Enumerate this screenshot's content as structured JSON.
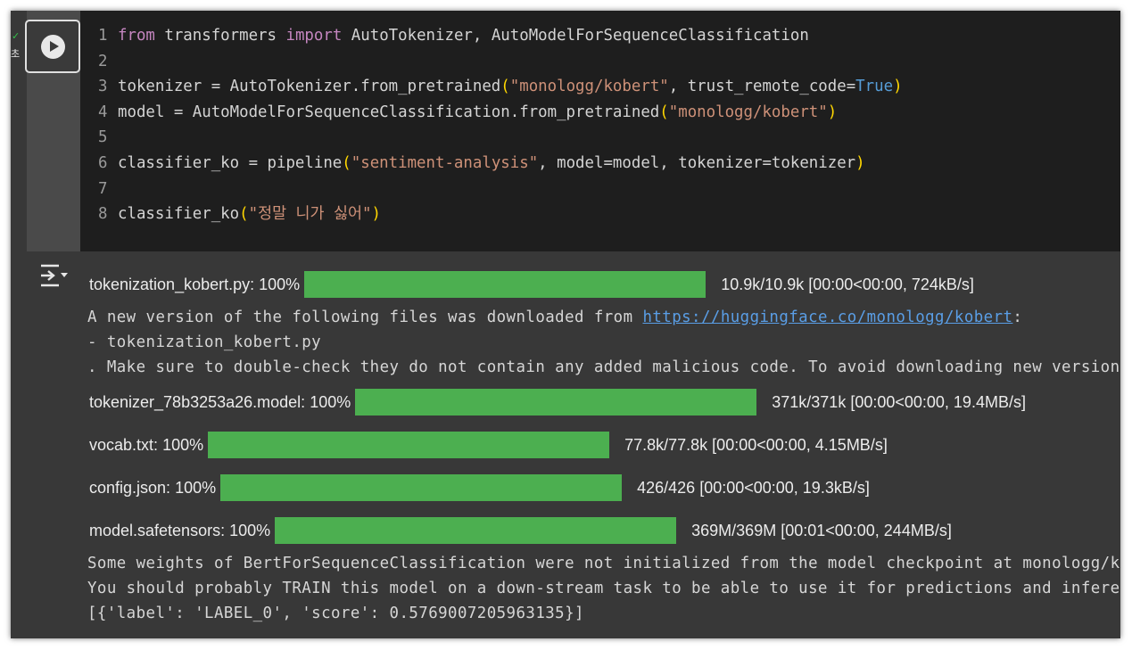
{
  "cell": {
    "status_check": "✓",
    "status_time": "초",
    "code_lines": [
      {
        "n": "1",
        "parts": [
          [
            "kw",
            "from"
          ],
          [
            "p",
            " transformers "
          ],
          [
            "kw",
            "import"
          ],
          [
            "p",
            " AutoTokenizer, AutoModelForSequenceClassification"
          ]
        ]
      },
      {
        "n": "2",
        "parts": []
      },
      {
        "n": "3",
        "parts": [
          [
            "p",
            "tokenizer = AutoTokenizer.from_pretrained"
          ],
          [
            "paren",
            "("
          ],
          [
            "str",
            "\"monologg/kobert\""
          ],
          [
            "p",
            ", trust_remote_code="
          ],
          [
            "bool",
            "True"
          ],
          [
            "paren",
            ")"
          ]
        ]
      },
      {
        "n": "4",
        "parts": [
          [
            "p",
            "model = AutoModelForSequenceClassification.from_pretrained"
          ],
          [
            "paren",
            "("
          ],
          [
            "str",
            "\"monologg/kobert\""
          ],
          [
            "paren",
            ")"
          ]
        ]
      },
      {
        "n": "5",
        "parts": []
      },
      {
        "n": "6",
        "parts": [
          [
            "p",
            "classifier_ko = pipeline"
          ],
          [
            "paren",
            "("
          ],
          [
            "str",
            "\"sentiment-analysis\""
          ],
          [
            "p",
            ", model=model, tokenizer=tokenizer"
          ],
          [
            "paren",
            ")"
          ]
        ]
      },
      {
        "n": "7",
        "parts": []
      },
      {
        "n": "8",
        "parts": [
          [
            "p",
            "classifier_ko"
          ],
          [
            "paren",
            "("
          ],
          [
            "str",
            "\"정말 니가 싫어\""
          ],
          [
            "paren",
            ")"
          ]
        ]
      }
    ]
  },
  "output": {
    "progress_bars": [
      {
        "name": "tokenization_kobert.py:",
        "percent_label": "100%",
        "fill": 1.0,
        "stats": "10.9k/10.9k [00:00<00:00, 724kB/s]"
      },
      {
        "name": "tokenizer_78b3253a26.model:",
        "percent_label": "100%",
        "fill": 1.0,
        "stats": "371k/371k [00:00<00:00, 19.4MB/s]"
      },
      {
        "name": "vocab.txt:",
        "percent_label": "100%",
        "fill": 1.0,
        "stats": "77.8k/77.8k [00:00<00:00, 4.15MB/s]"
      },
      {
        "name": "config.json:",
        "percent_label": "100%",
        "fill": 1.0,
        "stats": "426/426 [00:00<00:00, 19.3kB/s]"
      },
      {
        "name": "model.safetensors:",
        "percent_label": "100%",
        "fill": 1.0,
        "stats": "369M/369M [00:01<00:00, 244MB/s]"
      }
    ],
    "warning_prefix": "A new version of the following files was downloaded from ",
    "warning_link": "https://huggingface.co/monologg/kobert",
    "warning_suffix": ":",
    "warning_file": "- tokenization_kobert.py",
    "warning_tail": ". Make sure to double-check they do not contain any added malicious code. To avoid downloading new versions",
    "weights_line_1": "Some weights of BertForSequenceClassification were not initialized from the model checkpoint at monologg/kobert",
    "weights_line_2": "You should probably TRAIN this model on a down-stream task to be able to use it for predictions and inference.",
    "result": "[{'label': 'LABEL_0', 'score': 0.5769007205963135}]"
  },
  "colors": {
    "bar_fill": "#4caf50",
    "string": "#ce9178",
    "keyword": "#c586c0",
    "boolean": "#569cd6",
    "link": "#5a9ee6"
  }
}
